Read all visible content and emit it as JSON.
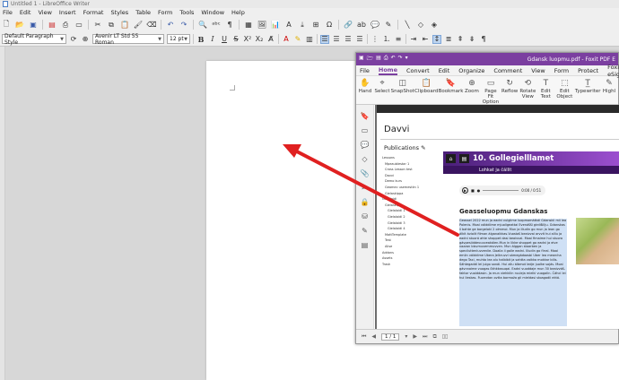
{
  "writer": {
    "title": "Untitled 1 - LibreOffice Writer",
    "menu": [
      "File",
      "Edit",
      "View",
      "Insert",
      "Format",
      "Styles",
      "Table",
      "Form",
      "Tools",
      "Window",
      "Help"
    ],
    "paragraph_style": "Default Paragraph Style",
    "font_name": "Avenir LT Std 55 Roman",
    "font_size": "12 pt"
  },
  "foxit": {
    "title": "Gdansk luopmu.pdf - Foxit PDF E",
    "tabs": [
      "File",
      "Home",
      "Convert",
      "Edit",
      "Organize",
      "Comment",
      "View",
      "Form",
      "Protect",
      "Foxit eSign"
    ],
    "active_tab": "Home",
    "ribbon": [
      {
        "icon": "hand-icon",
        "label": "Hand"
      },
      {
        "icon": "select-icon",
        "label": "Select"
      },
      {
        "icon": "snapshot-icon",
        "label": "SnapShot"
      },
      {
        "icon": "clipboard-icon",
        "label": "Clipboard"
      },
      {
        "icon": "bookmark-icon",
        "label": "Bookmark"
      },
      {
        "icon": "zoom-icon",
        "label": "Zoom"
      },
      {
        "icon": "page-fit-icon",
        "label": "Page Fit Option"
      },
      {
        "icon": "reflow-icon",
        "label": "Reflow"
      },
      {
        "icon": "rotate-icon",
        "label": "Rotate View"
      },
      {
        "icon": "edit-text-icon",
        "label": "Edit Text"
      },
      {
        "icon": "edit-object-icon",
        "label": "Edit Object"
      },
      {
        "icon": "typewriter-icon",
        "label": "Typewriter"
      },
      {
        "icon": "highlight-icon",
        "label": "Highl"
      }
    ],
    "page_indicator": "1 / 1"
  },
  "pdf": {
    "site_title": "Davvi",
    "publications_label": "Publications",
    "nav": [
      {
        "label": "Lessons",
        "level": 0
      },
      {
        "label": "Mpeaublestar 1",
        "level": 1
      },
      {
        "label": "Cross Lesson test",
        "level": 1
      },
      {
        "label": "Davvi",
        "level": 1
      },
      {
        "label": "Demo kurs",
        "level": 1
      },
      {
        "label": "Geamec usemestiin 1",
        "level": 1
      },
      {
        "label": "Gielaskippa",
        "level": 1
      },
      {
        "label": "Gielalaidi",
        "level": 0
      },
      {
        "label": "Gielaskippa",
        "level": 1
      },
      {
        "label": "Gielalaidi 1",
        "level": 2
      },
      {
        "label": "Gielalaidi 2",
        "level": 2
      },
      {
        "label": "Gielalaidi 3",
        "level": 2
      },
      {
        "label": "Gielalaidi 4",
        "level": 2
      },
      {
        "label": "MattTemplate",
        "level": 1
      },
      {
        "label": "Test",
        "level": 1
      },
      {
        "label": "Alise",
        "level": 1
      },
      {
        "label": "Addons",
        "level": 0
      },
      {
        "label": "Assets",
        "level": 0
      },
      {
        "label": "Trash",
        "level": 0
      }
    ],
    "chapter_title": "10. Gollegielllamet",
    "chapter_subtitle": "Lohkat ja čállit",
    "audio_time": "0:00 / 0:51",
    "heading": "Geasseluopmu Gdanskas",
    "paragraph": "Geassel 2022 mun ja eadni vulgiime luopmomátkái Gdanskii mii lea Polenis. Moai válddiime mjuoligeattai Evenášši girdišillju. Gdanskas ii bahte ge borgeloki 2 olmmoi. Mun ja illudin go mun ja lean go álkit áviolit filman álganaikkas.Vuostaš beaivvai arvvit hui alliu ja eadni stuorá ahte shoppet dasi beaivvai. Moai fimaime hui stuora gávpesiiddevuvveakálen.Mun in likke shoppet go eadni ja eive vazzan bisvmuvemmuvven. Mun álggan stoarben ja speciluttenluvvenlie. Doaila ii galle eadni. Illudin go fírral. Moai emiin válddime Ubera Jelkruvvi sámegádaasbi Uber lea mearcha dego Taxi, muhto lea olu halbibit ja sahtta vaikka mokkar bilis. Sáhtegaddi lei juigo sanái. Hui allu álbmot ledje juolke sojás. Moai gávnnaime vuogas čáhkkasuqai. Eadni vuoddaje mun 30 beaivváš-faktor vuoiddasin. Ja mun viehkilin ruuleja mielki vuogalin. Čáhci lei hui lieskas. Fuorrotan ovtta bormoža gii mieldasi stoagadii ektá."
  },
  "colors": {
    "foxit_accent": "#7b3fa0",
    "chapter_bar": "#6a2fa0",
    "arrow": "#e02020",
    "selection": "#cfe0f5"
  }
}
